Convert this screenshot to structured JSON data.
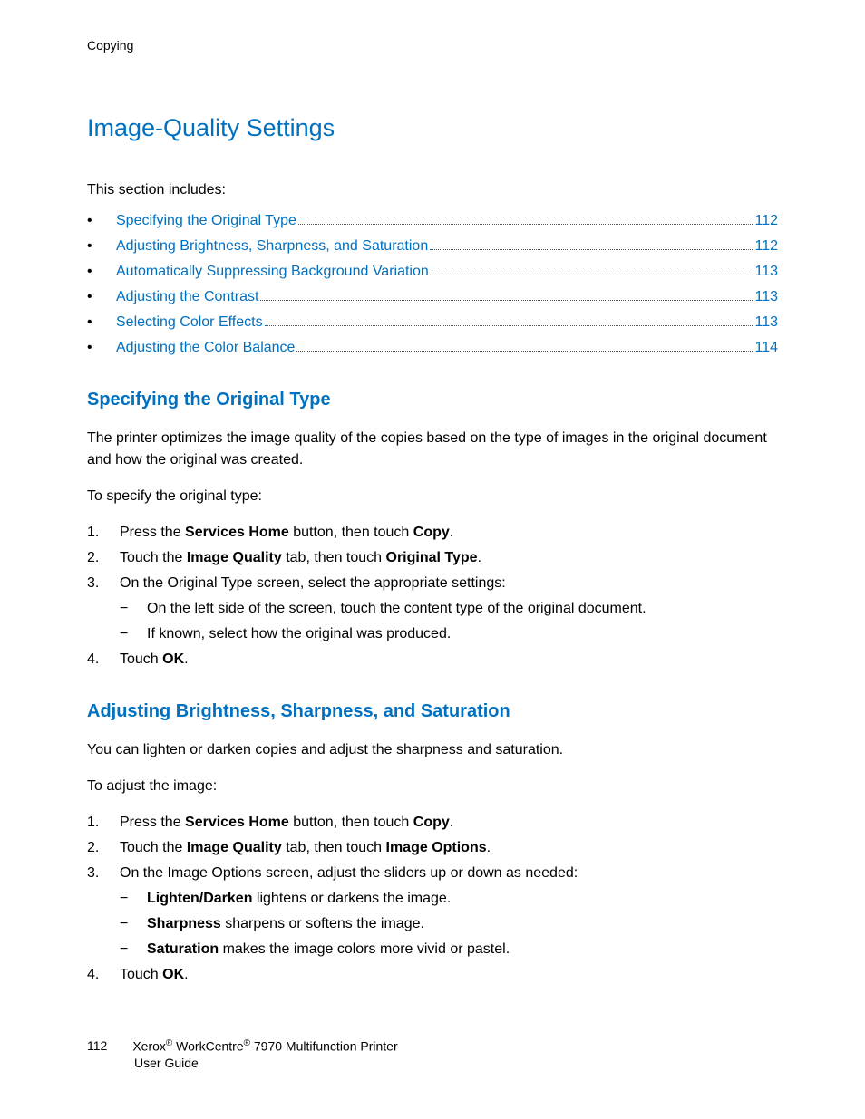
{
  "running_header": "Copying",
  "title": "Image-Quality Settings",
  "intro": "This section includes:",
  "toc": [
    {
      "label": "Specifying the Original Type",
      "page": "112"
    },
    {
      "label": "Adjusting Brightness, Sharpness, and Saturation",
      "page": "112"
    },
    {
      "label": "Automatically Suppressing Background Variation",
      "page": "113"
    },
    {
      "label": "Adjusting the Contrast",
      "page": "113"
    },
    {
      "label": "Selecting Color Effects",
      "page": "113"
    },
    {
      "label": "Adjusting the Color Balance",
      "page": "114"
    }
  ],
  "s1": {
    "heading": "Specifying the Original Type",
    "para1": "The printer optimizes the image quality of the copies based on the type of images in the original document and how the original was created.",
    "lead": "To specify the original type:",
    "step1a": "Press the ",
    "step1b": "Services Home",
    "step1c": " button, then touch ",
    "step1d": "Copy",
    "step1e": ".",
    "step2a": "Touch the ",
    "step2b": "Image Quality",
    "step2c": " tab, then touch ",
    "step2d": "Original Type",
    "step2e": ".",
    "step3": "On the Original Type screen, select the appropriate settings:",
    "sub1": "On the left side of the screen, touch the content type of the original document.",
    "sub2": "If known, select how the original was produced.",
    "step4a": "Touch ",
    "step4b": "OK",
    "step4c": "."
  },
  "s2": {
    "heading": "Adjusting Brightness, Sharpness, and Saturation",
    "para1": "You can lighten or darken copies and adjust the sharpness and saturation.",
    "lead": "To adjust the image:",
    "step1a": "Press the ",
    "step1b": "Services Home",
    "step1c": " button, then touch ",
    "step1d": "Copy",
    "step1e": ".",
    "step2a": "Touch the ",
    "step2b": "Image Quality",
    "step2c": " tab, then touch ",
    "step2d": "Image Options",
    "step2e": ".",
    "step3": "On the Image Options screen, adjust the sliders up or down as needed:",
    "sub1b": "Lighten/Darken",
    "sub1t": " lightens or darkens the image.",
    "sub2b": "Sharpness",
    "sub2t": " sharpens or softens the image.",
    "sub3b": "Saturation",
    "sub3t": " makes the image colors more vivid or pastel.",
    "step4a": "Touch ",
    "step4b": "OK",
    "step4c": "."
  },
  "footer": {
    "page": "112",
    "brand1": "Xerox",
    "reg": "®",
    "brand2": " WorkCentre",
    "tail": " 7970 Multifunction Printer",
    "line2": "User Guide"
  }
}
